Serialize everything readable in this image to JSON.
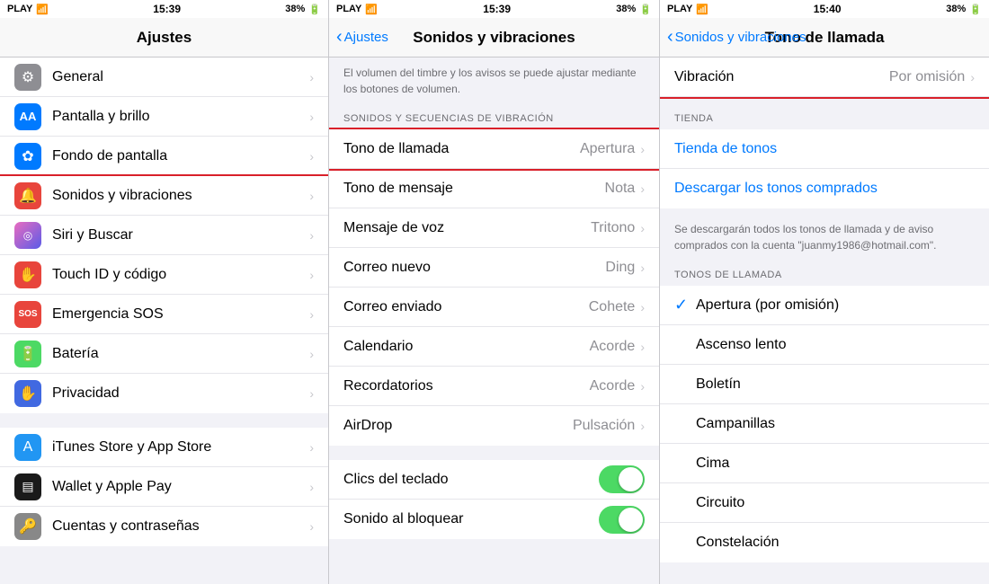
{
  "colors": {
    "blue": "#007aff",
    "red": "#d9202a",
    "green": "#4cd964",
    "gray": "#8e8e93",
    "lightgray": "#c7c7cc"
  },
  "panel1": {
    "statusbar": {
      "carrier": "PLAY",
      "time": "15:39",
      "battery": "38%"
    },
    "title": "Ajustes",
    "items": [
      {
        "id": "general",
        "label": "General",
        "icon_bg": "#8e8e93",
        "icon": "⚙"
      },
      {
        "id": "pantalla",
        "label": "Pantalla y brillo",
        "icon_bg": "#007aff",
        "icon": "AA"
      },
      {
        "id": "fondo",
        "label": "Fondo de pantalla",
        "icon_bg": "#007aff",
        "icon": "✿"
      },
      {
        "id": "sonidos",
        "label": "Sonidos y vibraciones",
        "icon_bg": "#e8453c",
        "icon": "🔔",
        "highlighted": true
      },
      {
        "id": "siri",
        "label": "Siri y Buscar",
        "icon_bg": "#888",
        "icon": "◎"
      },
      {
        "id": "touchid",
        "label": "Touch ID y código",
        "icon_bg": "#e8453c",
        "icon": "✋"
      },
      {
        "id": "emergencia",
        "label": "Emergencia SOS",
        "icon_bg": "#e8453c",
        "icon": "SOS"
      },
      {
        "id": "bateria",
        "label": "Batería",
        "icon_bg": "#4cd964",
        "icon": "🔋"
      },
      {
        "id": "privacidad",
        "label": "Privacidad",
        "icon_bg": "#4169e1",
        "icon": "✋"
      }
    ],
    "items2": [
      {
        "id": "itunes",
        "label": "iTunes Store y App Store",
        "icon_bg": "#2196f3",
        "icon": "A"
      },
      {
        "id": "wallet",
        "label": "Wallet y Apple Pay",
        "icon_bg": "#1a1a1a",
        "icon": "▤"
      },
      {
        "id": "cuentas",
        "label": "Cuentas y contraseñas",
        "icon_bg": "#888",
        "icon": "🔑"
      }
    ]
  },
  "panel2": {
    "statusbar": {
      "carrier": "PLAY",
      "time": "15:39",
      "battery": "38%"
    },
    "back": "Ajustes",
    "title": "Sonidos y vibraciones",
    "description": "El volumen del timbre y los avisos se puede ajustar\nmediante los botones de volumen.",
    "section_header": "SONIDOS Y SECUENCIAS DE VIBRACIÓN",
    "items": [
      {
        "id": "tono_llamada",
        "label": "Tono de llamada",
        "value": "Apertura",
        "highlighted": true
      },
      {
        "id": "tono_mensaje",
        "label": "Tono de mensaje",
        "value": "Nota"
      },
      {
        "id": "mensaje_voz",
        "label": "Mensaje de voz",
        "value": "Tritono"
      },
      {
        "id": "correo_nuevo",
        "label": "Correo nuevo",
        "value": "Ding"
      },
      {
        "id": "correo_enviado",
        "label": "Correo enviado",
        "value": "Cohete"
      },
      {
        "id": "calendario",
        "label": "Calendario",
        "value": "Acorde"
      },
      {
        "id": "recordatorios",
        "label": "Recordatorios",
        "value": "Acorde"
      },
      {
        "id": "airdrop",
        "label": "AirDrop",
        "value": "Pulsación"
      }
    ],
    "toggles": [
      {
        "id": "clics_teclado",
        "label": "Clics del teclado",
        "on": true
      },
      {
        "id": "sonido_bloquear",
        "label": "Sonido al bloquear",
        "on": true
      }
    ]
  },
  "panel3": {
    "statusbar": {
      "carrier": "PLAY",
      "time": "15:40",
      "battery": "38%"
    },
    "back": "Sonidos y vibraciones",
    "title": "Tono de llamada",
    "vibration_label": "Vibración",
    "vibration_value": "Por omisión",
    "section_tienda": "TIENDA",
    "tienda_link1": "Tienda de tonos",
    "tienda_link2": "Descargar los tonos comprados",
    "download_note": "Se descargarán todos los tonos de llamada y de aviso\ncomprados con la cuenta \"juanmy1986@hotmail.com\".",
    "section_tonos": "TONOS DE LLAMADA",
    "tones": [
      {
        "id": "apertura",
        "label": "Apertura (por omisión)",
        "checked": true
      },
      {
        "id": "ascenso",
        "label": "Ascenso lento",
        "checked": false
      },
      {
        "id": "boletin",
        "label": "Boletín",
        "checked": false
      },
      {
        "id": "campanillas",
        "label": "Campanillas",
        "checked": false
      },
      {
        "id": "cima",
        "label": "Cima",
        "checked": false
      },
      {
        "id": "circuito",
        "label": "Circuito",
        "checked": false
      },
      {
        "id": "constelacion",
        "label": "Constelación",
        "checked": false
      }
    ]
  }
}
